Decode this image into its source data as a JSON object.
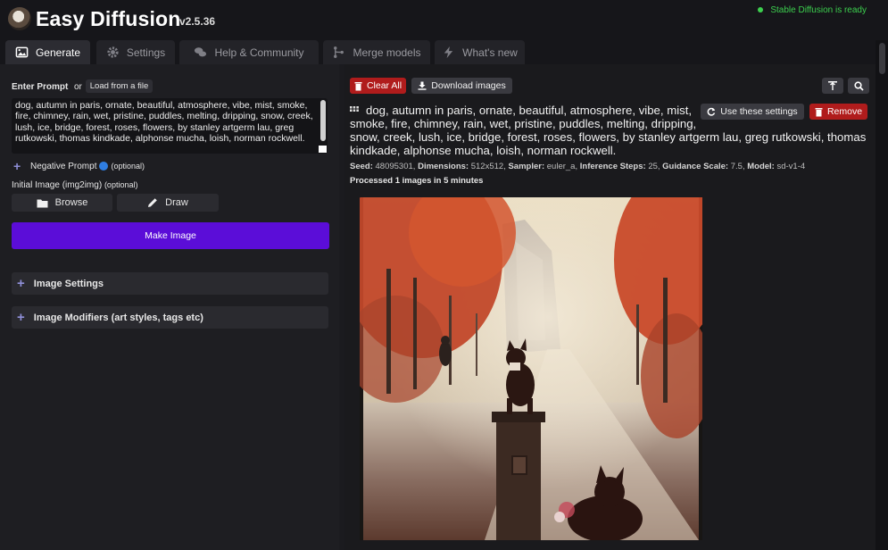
{
  "app": {
    "title": "Easy Diffusion",
    "version": "v2.5.36",
    "status": "Stable Diffusion is ready"
  },
  "colors": {
    "accent": "#5b0dd8",
    "danger": "#b01c1c",
    "status_ok": "#3ccf4e"
  },
  "tabs": [
    {
      "label": "Generate",
      "icon": "image-icon",
      "active": true
    },
    {
      "label": "Settings",
      "icon": "gear-icon",
      "active": false
    },
    {
      "label": "Help & Community",
      "icon": "chat-icon",
      "active": false
    },
    {
      "label": "Merge models",
      "icon": "merge-icon",
      "active": false
    },
    {
      "label": "What's new",
      "icon": "bolt-icon",
      "active": false
    }
  ],
  "left": {
    "prompt_label": "Enter Prompt",
    "or_text": "or",
    "load_file": "Load from a file",
    "prompt_text": "dog, autumn in paris, ornate, beautiful, atmosphere, vibe, mist, smoke, fire, chimney, rain, wet, pristine, puddles, melting, dripping, snow, creek, lush, ice, bridge, forest, roses, flowers, by stanley artgerm lau, greg rutkowski, thomas kindkade, alphonse mucha, loish, norman rockwell.",
    "negative_label": "Negative Prompt",
    "negative_optional": "(optional)",
    "initial_label": "Initial Image (img2img)",
    "initial_optional": "(optional)",
    "browse": "Browse",
    "draw": "Draw",
    "make_image": "Make Image",
    "image_settings": "Image Settings",
    "image_modifiers": "Image Modifiers (art styles, tags etc)"
  },
  "right": {
    "clear_all": "Clear All",
    "download_images": "Download images",
    "result_prompt": "dog, autumn in paris, ornate, beautiful, atmosphere, vibe, mist, smoke, fire, chimney, rain, wet, pristine, puddles, melting, dripping, snow, creek, lush, ice, bridge, forest, roses, flowers, by stanley artgerm lau, greg rutkowski, thomas kindkade, alphonse mucha, loish, norman rockwell.",
    "use_settings": "Use these settings",
    "remove": "Remove",
    "meta": {
      "seed_label": "Seed:",
      "seed": "48095301",
      "dimensions_label": "Dimensions:",
      "dimensions": "512x512",
      "sampler_label": "Sampler:",
      "sampler": "euler_a",
      "steps_label": "Inference Steps:",
      "steps": "25",
      "guidance_label": "Guidance Scale:",
      "guidance": "7.5",
      "model_label": "Model:",
      "model": "sd-v1-4"
    },
    "processed": "Processed 1 images in 5 minutes"
  }
}
